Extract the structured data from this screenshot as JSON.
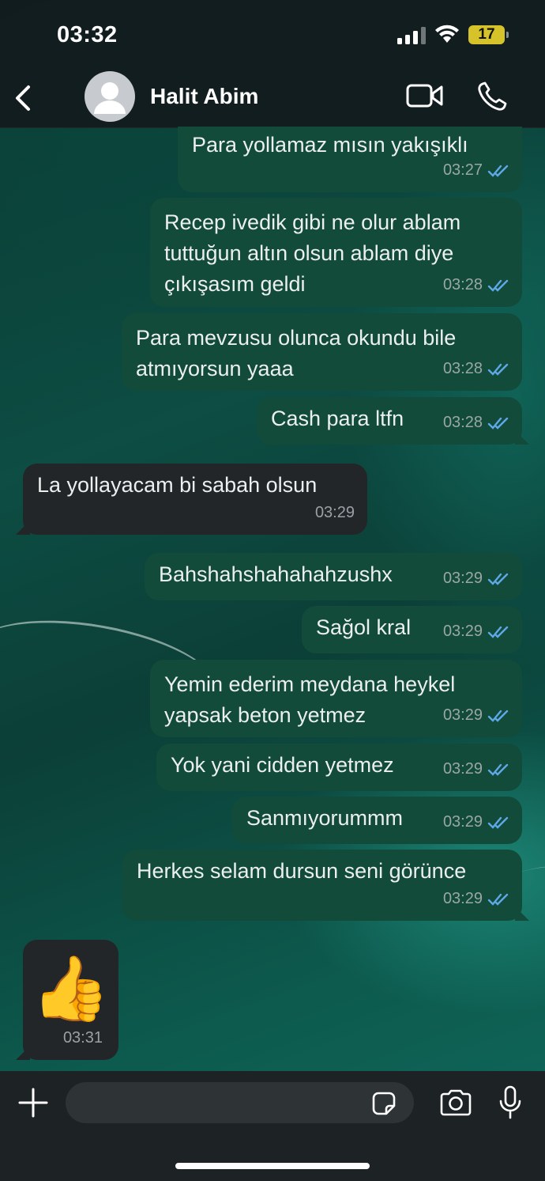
{
  "status_bar": {
    "time": "03:32",
    "battery": "17",
    "battery_color": "#d6c32a"
  },
  "header": {
    "contact_name": "Halit Abim",
    "icons": [
      "back-chevron-icon",
      "avatar-placeholder",
      "video-camera-icon",
      "phone-icon"
    ]
  },
  "messages": [
    {
      "direction": "out",
      "text": "Para yollamaz mısın yakışıklı",
      "time": "03:27",
      "status": "read"
    },
    {
      "direction": "out",
      "text": "Recep ivedik gibi ne olur ablam\ntuttuğun altın olsun ablam diye\nçıkışasım geldi",
      "time": "03:28",
      "status": "read"
    },
    {
      "direction": "out",
      "text": "Para mevzusu olunca okundu bile\natmıyorsun yaaa",
      "time": "03:28",
      "status": "read"
    },
    {
      "direction": "out",
      "text": "Cash para ltfn",
      "time": "03:28",
      "status": "read"
    },
    {
      "direction": "in",
      "text": "La yollayacam bi sabah olsun",
      "time": "03:29"
    },
    {
      "direction": "out",
      "text": "Bahshahshahahahzushx",
      "time": "03:29",
      "status": "read"
    },
    {
      "direction": "out",
      "text": "Sağol kral",
      "time": "03:29",
      "status": "read"
    },
    {
      "direction": "out",
      "text": "Yemin ederim meydana heykel\nyapsak beton yetmez",
      "time": "03:29",
      "status": "read"
    },
    {
      "direction": "out",
      "text": "Yok yani cidden yetmez",
      "time": "03:29",
      "status": "read"
    },
    {
      "direction": "out",
      "text": "Sanmıyorummm",
      "time": "03:29",
      "status": "read"
    },
    {
      "direction": "out",
      "text": "Herkes selam dursun seni görünce",
      "time": "03:29",
      "status": "read"
    },
    {
      "direction": "in",
      "text": "👍",
      "time": "03:31",
      "kind": "emoji"
    }
  ],
  "input_bar": {
    "placeholder": "",
    "icons": [
      "plus-icon",
      "sticker-icon",
      "camera-icon",
      "microphone-icon"
    ]
  },
  "colors": {
    "outgoing_bubble": "#124b39",
    "incoming_bubble": "#232629",
    "read_ticks": "#5fa8e8"
  }
}
